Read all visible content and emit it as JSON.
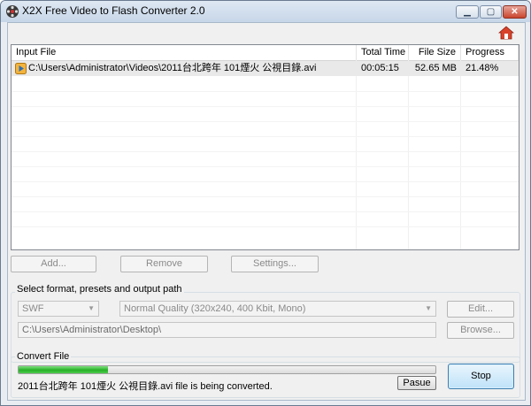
{
  "window": {
    "title": "X2X Free Video to Flash Converter 2.0",
    "controls": {
      "minimize": "▁",
      "maximize": "▢",
      "close": "✕"
    }
  },
  "icons": {
    "app": "film-reel-icon",
    "home": "home-icon",
    "file": "video-file-icon"
  },
  "colors": {
    "progress_fill": "#27b127",
    "accent": "#3c7fb1"
  },
  "file_list": {
    "columns": [
      "Input File",
      "Total Time",
      "File Size",
      "Progress"
    ],
    "rows": [
      {
        "input_file": "C:\\Users\\Administrator\\Videos\\2011台北跨年 101煙火 公視目錄.avi",
        "total_time": "00:05:15",
        "file_size": "52.65 MB",
        "progress": "21.48%"
      }
    ]
  },
  "actions": {
    "add": "Add...",
    "remove": "Remove",
    "settings": "Settings..."
  },
  "output": {
    "group_label": "Select format, presets and output path",
    "format": "SWF",
    "preset": "Normal Quality (320x240, 400 Kbit, Mono)",
    "edit": "Edit...",
    "path": "C:\\Users\\Administrator\\Desktop\\",
    "browse": "Browse..."
  },
  "convert": {
    "group_label": "Convert File",
    "progress_percent": 21.48,
    "status": "2011台北跨年 101煙火 公視目錄.avi file is being converted.",
    "pause": "Pasue",
    "stop": "Stop"
  }
}
